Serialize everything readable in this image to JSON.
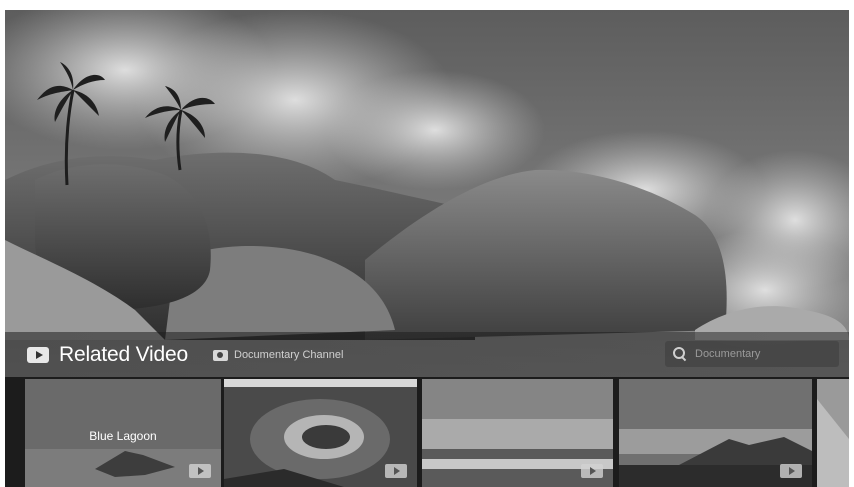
{
  "section": {
    "title": "Related Video",
    "channel_label": "Documentary Channel"
  },
  "search": {
    "placeholder": "Documentary"
  },
  "thumbnails": [
    {
      "title": "Blue Lagoon",
      "icon": "play-icon"
    },
    {
      "title": "",
      "icon": "play-icon"
    },
    {
      "title": "",
      "icon": "play-icon"
    },
    {
      "title": "",
      "icon": "play-icon"
    },
    {
      "title": "",
      "icon": "play-icon"
    }
  ],
  "colors": {
    "bar_overlay": "#1e1e1e",
    "text": "#ffffff",
    "muted_text": "#d0d0d0"
  }
}
